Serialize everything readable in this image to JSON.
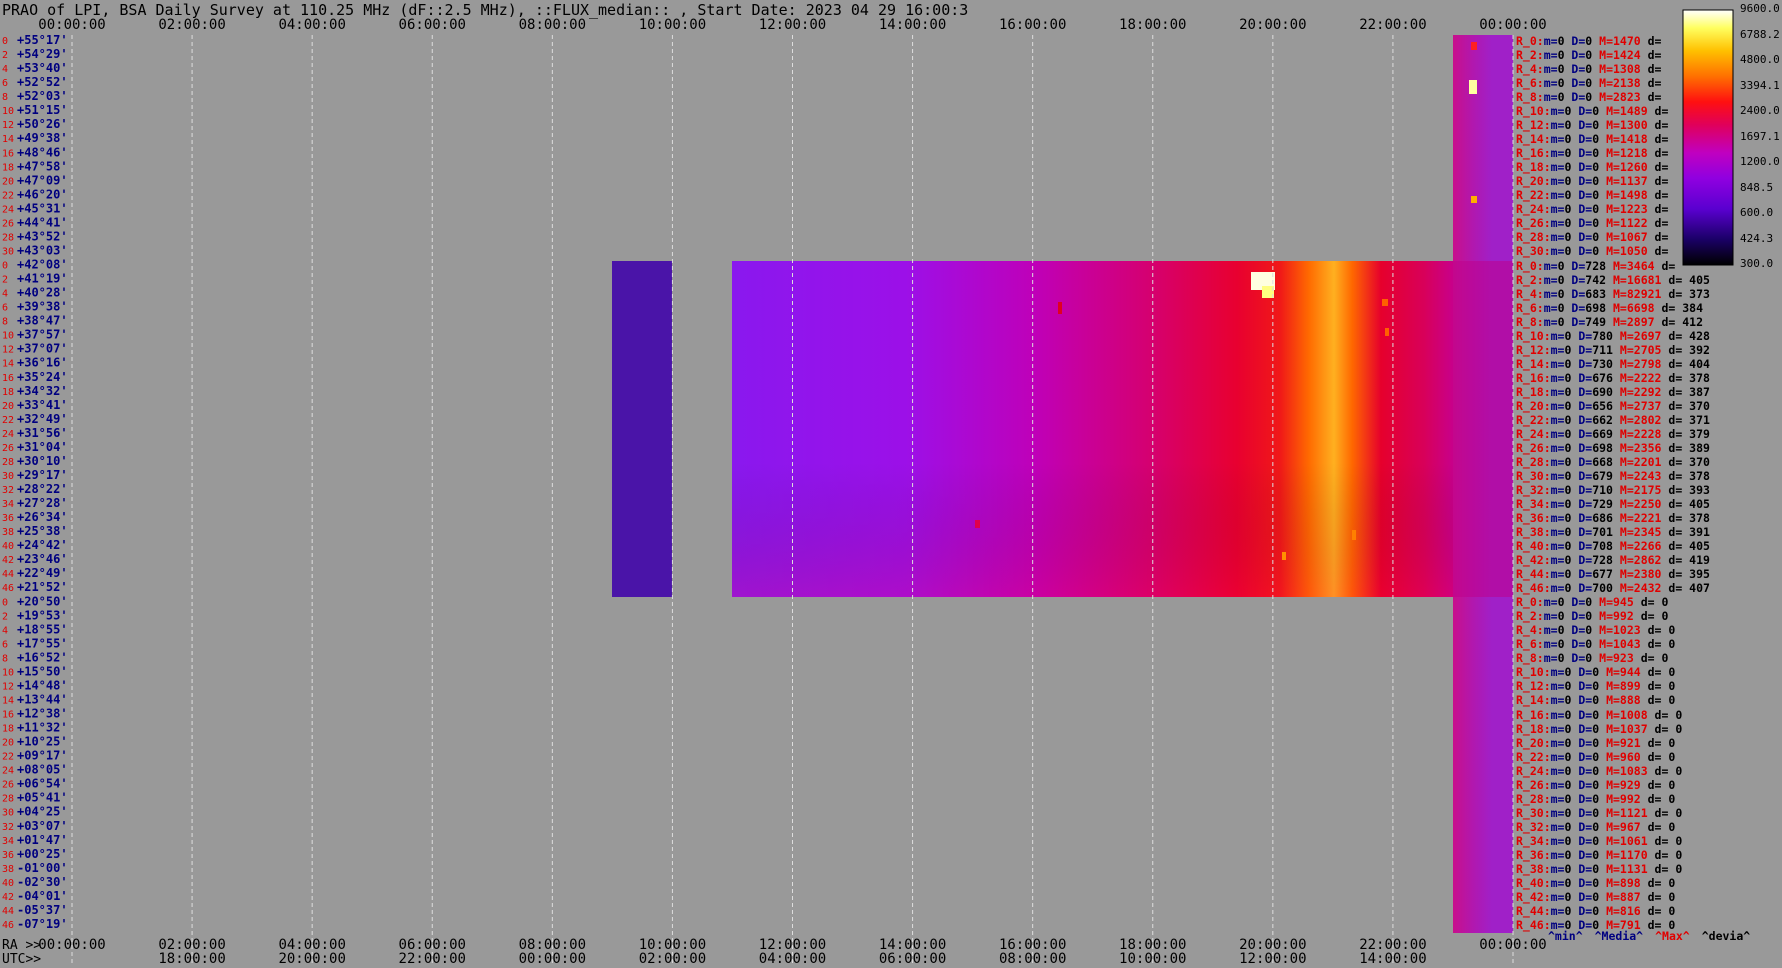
{
  "title": "PRAO of LPI, BSA Daily Survey at 110.25 MHz (dF::2.5 MHz), ::FLUX_median:: , Start Date: 2023 04 29 16:00:3",
  "colors": {
    "background": "#999999",
    "grid": "#dddddd",
    "axis_red": "#e00000",
    "axis_navy": "#000080"
  },
  "chart_data": {
    "type": "heatmap",
    "title": "PRAO of LPI, BSA Daily Survey at 110.25 MHz (dF::2.5 MHz), ::FLUX_median:: , Start Date: 2023 04 29 16:00:3",
    "colormap": "black-blue-purple-magenta-red-orange-yellow-white",
    "colorbar": {
      "ticks": [
        "9600.0",
        "6788.2",
        "4800.0",
        "3394.1",
        "2400.0",
        "1697.1",
        "1200.0",
        "848.5",
        "600.0",
        "424.3",
        "300.0"
      ],
      "range": [
        300.0,
        9600.0
      ],
      "scale": "log"
    },
    "x_top_ticks": [
      "00:00:00",
      "02:00:00",
      "04:00:00",
      "06:00:00",
      "08:00:00",
      "10:00:00",
      "12:00:00",
      "14:00:00",
      "16:00:00",
      "18:00:00",
      "20:00:00",
      "22:00:00",
      "00:00:00"
    ],
    "x_bottom_ra_label": "RA >>",
    "x_bottom_ra_ticks": [
      "00:00:00",
      "02:00:00",
      "04:00:00",
      "06:00:00",
      "08:00:00",
      "10:00:00",
      "12:00:00",
      "14:00:00",
      "16:00:00",
      "18:00:00",
      "20:00:00",
      "22:00:00",
      "00:00:00"
    ],
    "x_bottom_utc_label": "UTC>>",
    "x_bottom_utc_ticks": [
      "18:00:00",
      "20:00:00",
      "22:00:00",
      "00:00:00",
      "02:00:00",
      "04:00:00",
      "06:00:00",
      "08:00:00",
      "10:00:00",
      "12:00:00",
      "14:00:00"
    ],
    "grid": true,
    "row_indices": [
      "0",
      "2",
      "4",
      "6",
      "8",
      "10",
      "12",
      "14",
      "16",
      "18",
      "20",
      "22",
      "24",
      "26",
      "28",
      "30",
      "0",
      "2",
      "4",
      "6",
      "8",
      "10",
      "12",
      "14",
      "16",
      "18",
      "20",
      "22",
      "24",
      "26",
      "28",
      "30",
      "32",
      "34",
      "36",
      "38",
      "40",
      "42",
      "44",
      "46",
      "0",
      "2",
      "4",
      "6",
      "8",
      "10",
      "12",
      "14",
      "16",
      "18",
      "20",
      "22",
      "24",
      "26",
      "28",
      "30",
      "32",
      "34",
      "36",
      "38",
      "40",
      "42",
      "44",
      "46"
    ],
    "declinations": [
      "+55°17'",
      "+54°29'",
      "+53°40'",
      "+52°52'",
      "+52°03'",
      "+51°15'",
      "+50°26'",
      "+49°38'",
      "+48°46'",
      "+47°58'",
      "+47°09'",
      "+46°20'",
      "+45°31'",
      "+44°41'",
      "+43°52'",
      "+43°03'",
      "+42°08'",
      "+41°19'",
      "+40°28'",
      "+39°38'",
      "+38°47'",
      "+37°57'",
      "+37°07'",
      "+36°16'",
      "+35°24'",
      "+34°32'",
      "+33°41'",
      "+32°49'",
      "+31°56'",
      "+31°04'",
      "+30°10'",
      "+29°17'",
      "+28°22'",
      "+27°28'",
      "+26°34'",
      "+25°38'",
      "+24°42'",
      "+23°46'",
      "+22°49'",
      "+21°52'",
      "+20°50'",
      "+19°53'",
      "+18°55'",
      "+17°55'",
      "+16°52'",
      "+15°50'",
      "+14°48'",
      "+13°44'",
      "+12°38'",
      "+11°32'",
      "+10°25'",
      "+09°17'",
      "+08°05'",
      "+06°54'",
      "+05°41'",
      "+04°25'",
      "+03°07'",
      "+01°47'",
      "+00°25'",
      "-01°00'",
      "-02°30'",
      "-04°01'",
      "-05°37'",
      "-07°19'"
    ],
    "stats": [
      {
        "label": "R_0:",
        "m": "0",
        "D": "0",
        "M": "1470",
        "d": ""
      },
      {
        "label": "R_2:",
        "m": "0",
        "D": "0",
        "M": "1424",
        "d": ""
      },
      {
        "label": "R_4:",
        "m": "0",
        "D": "0",
        "M": "1308",
        "d": ""
      },
      {
        "label": "R_6:",
        "m": "0",
        "D": "0",
        "M": "2138",
        "d": ""
      },
      {
        "label": "R_8:",
        "m": "0",
        "D": "0",
        "M": "2823",
        "d": ""
      },
      {
        "label": "R_10:",
        "m": "0",
        "D": "0",
        "M": "1489",
        "d": ""
      },
      {
        "label": "R_12:",
        "m": "0",
        "D": "0",
        "M": "1300",
        "d": ""
      },
      {
        "label": "R_14:",
        "m": "0",
        "D": "0",
        "M": "1418",
        "d": ""
      },
      {
        "label": "R_16:",
        "m": "0",
        "D": "0",
        "M": "1218",
        "d": ""
      },
      {
        "label": "R_18:",
        "m": "0",
        "D": "0",
        "M": "1260",
        "d": ""
      },
      {
        "label": "R_20:",
        "m": "0",
        "D": "0",
        "M": "1137",
        "d": ""
      },
      {
        "label": "R_22:",
        "m": "0",
        "D": "0",
        "M": "1498",
        "d": ""
      },
      {
        "label": "R_24:",
        "m": "0",
        "D": "0",
        "M": "1223",
        "d": ""
      },
      {
        "label": "R_26:",
        "m": "0",
        "D": "0",
        "M": "1122",
        "d": ""
      },
      {
        "label": "R_28:",
        "m": "0",
        "D": "0",
        "M": "1067",
        "d": ""
      },
      {
        "label": "R_30:",
        "m": "0",
        "D": "0",
        "M": "1050",
        "d": ""
      },
      {
        "label": "R_0:",
        "m": "0",
        "D": "728",
        "M": "3464",
        "d": ""
      },
      {
        "label": "R_2:",
        "m": "0",
        "D": "742",
        "M": "16681",
        "d": "405"
      },
      {
        "label": "R_4:",
        "m": "0",
        "D": "683",
        "M": "82921",
        "d": "373"
      },
      {
        "label": "R_6:",
        "m": "0",
        "D": "698",
        "M": "6698",
        "d": "384"
      },
      {
        "label": "R_8:",
        "m": "0",
        "D": "749",
        "M": "2897",
        "d": "412"
      },
      {
        "label": "R_10:",
        "m": "0",
        "D": "780",
        "M": "2697",
        "d": "428"
      },
      {
        "label": "R_12:",
        "m": "0",
        "D": "711",
        "M": "2705",
        "d": "392"
      },
      {
        "label": "R_14:",
        "m": "0",
        "D": "730",
        "M": "2798",
        "d": "404"
      },
      {
        "label": "R_16:",
        "m": "0",
        "D": "676",
        "M": "2222",
        "d": "378"
      },
      {
        "label": "R_18:",
        "m": "0",
        "D": "690",
        "M": "2292",
        "d": "387"
      },
      {
        "label": "R_20:",
        "m": "0",
        "D": "656",
        "M": "2737",
        "d": "370"
      },
      {
        "label": "R_22:",
        "m": "0",
        "D": "662",
        "M": "2802",
        "d": "371"
      },
      {
        "label": "R_24:",
        "m": "0",
        "D": "669",
        "M": "2228",
        "d": "379"
      },
      {
        "label": "R_26:",
        "m": "0",
        "D": "698",
        "M": "2356",
        "d": "389"
      },
      {
        "label": "R_28:",
        "m": "0",
        "D": "668",
        "M": "2201",
        "d": "370"
      },
      {
        "label": "R_30:",
        "m": "0",
        "D": "679",
        "M": "2243",
        "d": "378"
      },
      {
        "label": "R_32:",
        "m": "0",
        "D": "710",
        "M": "2175",
        "d": "393"
      },
      {
        "label": "R_34:",
        "m": "0",
        "D": "729",
        "M": "2250",
        "d": "405"
      },
      {
        "label": "R_36:",
        "m": "0",
        "D": "686",
        "M": "2221",
        "d": "378"
      },
      {
        "label": "R_38:",
        "m": "0",
        "D": "701",
        "M": "2345",
        "d": "391"
      },
      {
        "label": "R_40:",
        "m": "0",
        "D": "708",
        "M": "2266",
        "d": "405"
      },
      {
        "label": "R_42:",
        "m": "0",
        "D": "728",
        "M": "2862",
        "d": "419"
      },
      {
        "label": "R_44:",
        "m": "0",
        "D": "677",
        "M": "2380",
        "d": "395"
      },
      {
        "label": "R_46:",
        "m": "0",
        "D": "700",
        "M": "2432",
        "d": "407"
      },
      {
        "label": "R_0:",
        "m": "0",
        "D": "0",
        "M": "945",
        "d": "0"
      },
      {
        "label": "R_2:",
        "m": "0",
        "D": "0",
        "M": "992",
        "d": "0"
      },
      {
        "label": "R_4:",
        "m": "0",
        "D": "0",
        "M": "1023",
        "d": "0"
      },
      {
        "label": "R_6:",
        "m": "0",
        "D": "0",
        "M": "1043",
        "d": "0"
      },
      {
        "label": "R_8:",
        "m": "0",
        "D": "0",
        "M": "923",
        "d": "0"
      },
      {
        "label": "R_10:",
        "m": "0",
        "D": "0",
        "M": "944",
        "d": "0"
      },
      {
        "label": "R_12:",
        "m": "0",
        "D": "0",
        "M": "899",
        "d": "0"
      },
      {
        "label": "R_14:",
        "m": "0",
        "D": "0",
        "M": "888",
        "d": "0"
      },
      {
        "label": "R_16:",
        "m": "0",
        "D": "0",
        "M": "1008",
        "d": "0"
      },
      {
        "label": "R_18:",
        "m": "0",
        "D": "0",
        "M": "1037",
        "d": "0"
      },
      {
        "label": "R_20:",
        "m": "0",
        "D": "0",
        "M": "921",
        "d": "0"
      },
      {
        "label": "R_22:",
        "m": "0",
        "D": "0",
        "M": "960",
        "d": "0"
      },
      {
        "label": "R_24:",
        "m": "0",
        "D": "0",
        "M": "1083",
        "d": "0"
      },
      {
        "label": "R_26:",
        "m": "0",
        "D": "0",
        "M": "929",
        "d": "0"
      },
      {
        "label": "R_28:",
        "m": "0",
        "D": "0",
        "M": "992",
        "d": "0"
      },
      {
        "label": "R_30:",
        "m": "0",
        "D": "0",
        "M": "1121",
        "d": "0"
      },
      {
        "label": "R_32:",
        "m": "0",
        "D": "0",
        "M": "967",
        "d": "0"
      },
      {
        "label": "R_34:",
        "m": "0",
        "D": "0",
        "M": "1061",
        "d": "0"
      },
      {
        "label": "R_36:",
        "m": "0",
        "D": "0",
        "M": "1170",
        "d": "0"
      },
      {
        "label": "R_38:",
        "m": "0",
        "D": "0",
        "M": "1131",
        "d": "0"
      },
      {
        "label": "R_40:",
        "m": "0",
        "D": "0",
        "M": "898",
        "d": "0"
      },
      {
        "label": "R_42:",
        "m": "0",
        "D": "0",
        "M": "887",
        "d": "0"
      },
      {
        "label": "R_44:",
        "m": "0",
        "D": "0",
        "M": "816",
        "d": "0"
      },
      {
        "label": "R_46:",
        "m": "0",
        "D": "0",
        "M": "791",
        "d": "0"
      }
    ],
    "legend": [
      "^min^",
      "^Media^",
      "^Max^",
      "^devia^"
    ]
  }
}
